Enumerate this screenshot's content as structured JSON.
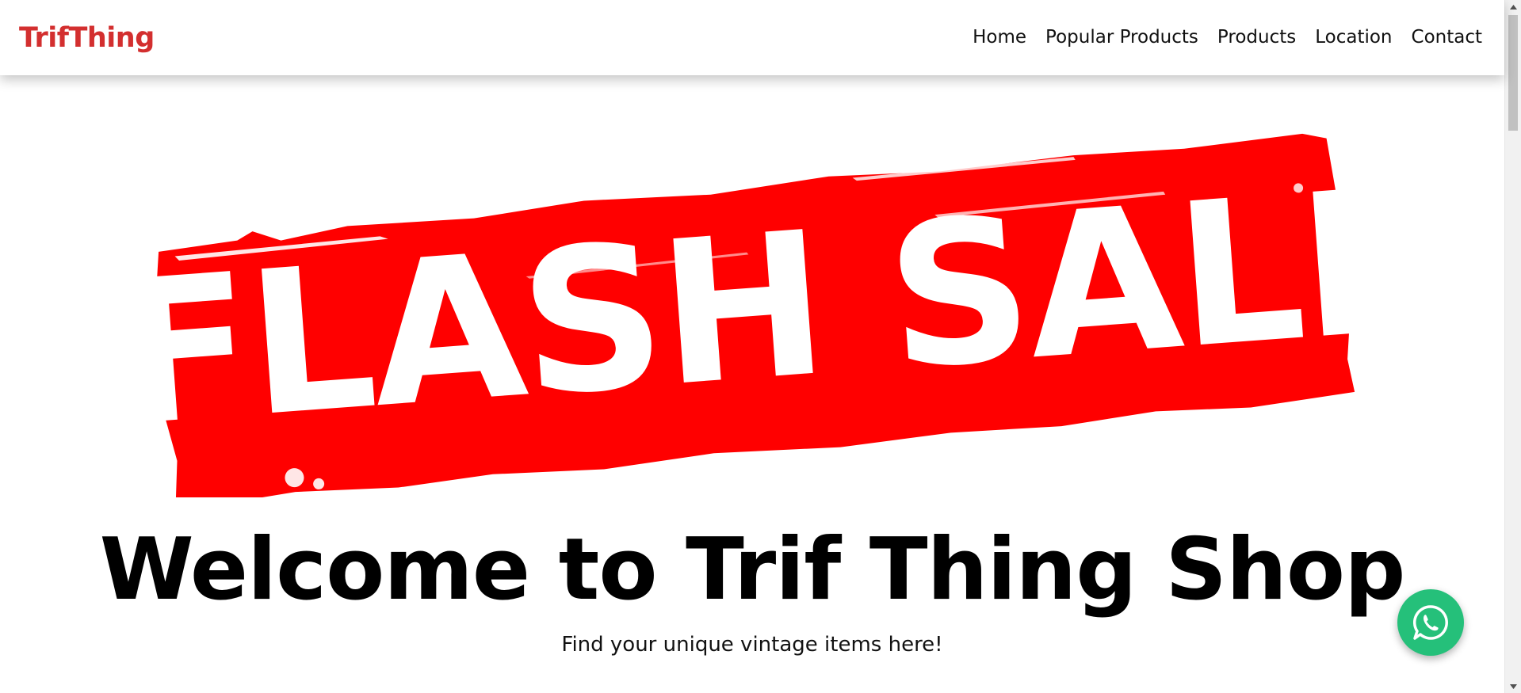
{
  "brand": {
    "name": "TrifThing",
    "color": "#d32f2f"
  },
  "nav": {
    "items": [
      {
        "label": "Home"
      },
      {
        "label": "Popular Products"
      },
      {
        "label": "Products"
      },
      {
        "label": "Location"
      },
      {
        "label": "Contact"
      }
    ]
  },
  "hero": {
    "banner_text": "FLASH SALE",
    "banner_color": "#ff0000",
    "title": "Welcome to Trif Thing Shop",
    "subtitle": "Find your unique vintage items here!"
  },
  "floating": {
    "icon": "whatsapp-icon",
    "color": "#25c07a"
  },
  "scrollbar": {
    "thumb_color": "#c1c1c1"
  }
}
